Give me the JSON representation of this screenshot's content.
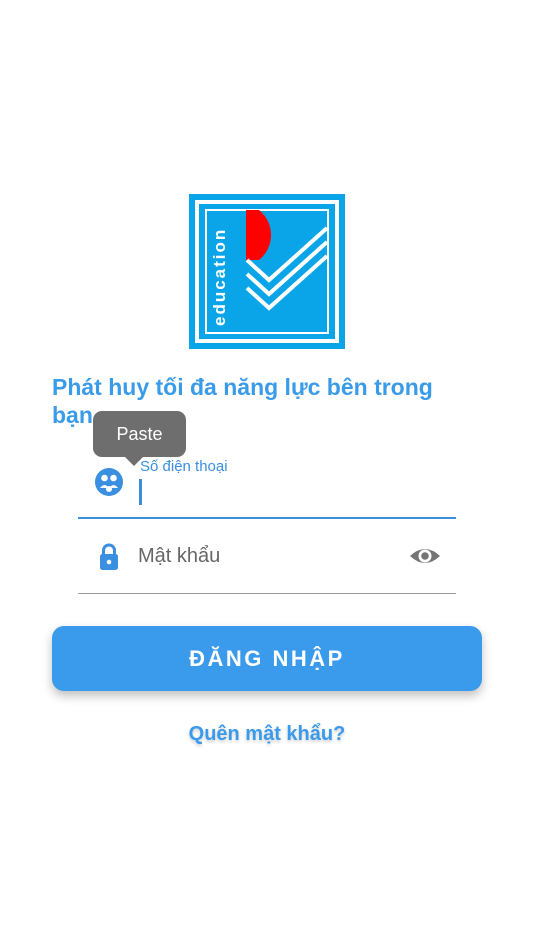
{
  "app": {
    "logo_text": "education",
    "tagline": "Phát huy tối đa năng lực bên trong bạn"
  },
  "tooltip": {
    "label": "Paste"
  },
  "form": {
    "phone": {
      "label": "Số điện thoại",
      "value": ""
    },
    "password": {
      "placeholder": "Mật khẩu",
      "value": ""
    },
    "login_label": "ĐĂNG NHẬP",
    "forgot_label": "Quên mật khẩu?"
  },
  "colors": {
    "primary": "#3a9aeb",
    "logo_blue": "#0aa4e8",
    "logo_red": "#ff0000"
  },
  "icons": {
    "phone_field": "user-group-icon",
    "password_field": "lock-icon",
    "toggle_visibility": "eye-icon"
  }
}
